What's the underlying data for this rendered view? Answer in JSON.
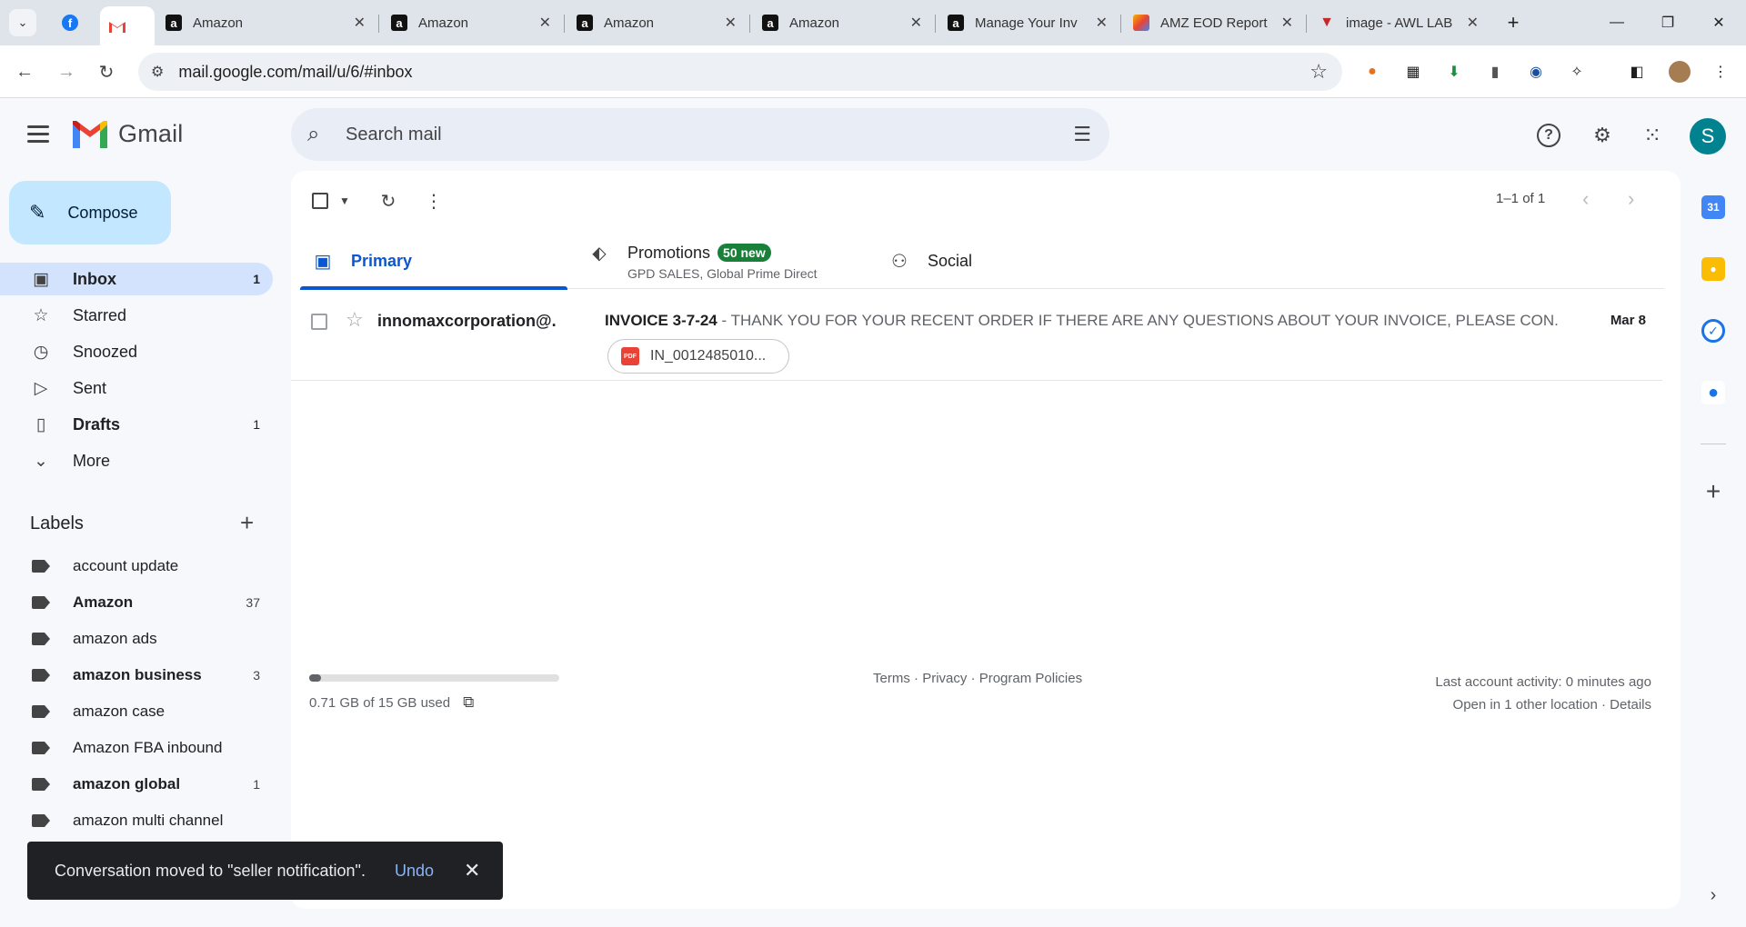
{
  "browser": {
    "tabs": [
      {
        "title": "",
        "icon": "facebook-icon"
      },
      {
        "title": "",
        "icon": "gmail-icon",
        "active": true
      },
      {
        "title": "Amazon",
        "icon": "amazon-icon"
      },
      {
        "title": "Amazon",
        "icon": "amazon-icon"
      },
      {
        "title": "Amazon",
        "icon": "amazon-icon"
      },
      {
        "title": "Amazon",
        "icon": "amazon-icon"
      },
      {
        "title": "Manage Your Inv",
        "icon": "amazon-icon"
      },
      {
        "title": "AMZ EOD Report",
        "icon": "sheets-icon"
      },
      {
        "title": "image - AWL LAB",
        "icon": "awl-icon"
      }
    ],
    "url": "mail.google.com/mail/u/6/#inbox"
  },
  "gmail": {
    "brand": "Gmail",
    "avatar_letter": "S",
    "search_placeholder": "Search mail",
    "compose_label": "Compose",
    "nav": [
      {
        "label": "Inbox",
        "count": "1",
        "active": true
      },
      {
        "label": "Starred",
        "count": ""
      },
      {
        "label": "Snoozed",
        "count": ""
      },
      {
        "label": "Sent",
        "count": ""
      },
      {
        "label": "Drafts",
        "count": "1"
      },
      {
        "label": "More",
        "count": ""
      }
    ],
    "labels_title": "Labels",
    "labels": [
      {
        "label": "account update",
        "count": ""
      },
      {
        "label": "Amazon",
        "count": "37"
      },
      {
        "label": "amazon ads",
        "count": ""
      },
      {
        "label": "amazon business",
        "count": "3"
      },
      {
        "label": "amazon case",
        "count": ""
      },
      {
        "label": "Amazon FBA inbound",
        "count": ""
      },
      {
        "label": "amazon global",
        "count": "1"
      },
      {
        "label": "amazon multi channel",
        "count": ""
      }
    ],
    "pager": "1–1 of 1",
    "categories": {
      "primary": "Primary",
      "promotions": "Promotions",
      "promotions_badge": "50 new",
      "promotions_sub": "GPD SALES, Global Prime Direct",
      "social": "Social"
    },
    "email": {
      "sender": "innomaxcorporation@.",
      "subject": "INVOICE 3-7-24",
      "snippet": " - THANK YOU FOR YOUR RECENT ORDER IF THERE ARE ANY QUESTIONS ABOUT YOUR INVOICE, PLEASE CON...",
      "date": "Mar 8",
      "attachment": "IN_0012485010...",
      "attachment_type": "PDF"
    },
    "storage": {
      "text": "0.71 GB of 15 GB used",
      "fraction": 0.047
    },
    "footer": {
      "terms": "Terms",
      "privacy": "Privacy",
      "policies": "Program Policies"
    },
    "activity": {
      "line1": "Last account activity: 0 minutes ago",
      "line2": "Open in 1 other location · Details"
    },
    "snackbar": {
      "message": "Conversation moved to \"seller notification\".",
      "action": "Undo"
    }
  },
  "colors": {
    "accent": "#0b57d0",
    "compose_bg": "#c2e7ff",
    "inbox_active": "#d3e3fd",
    "badge_green": "#188038"
  }
}
